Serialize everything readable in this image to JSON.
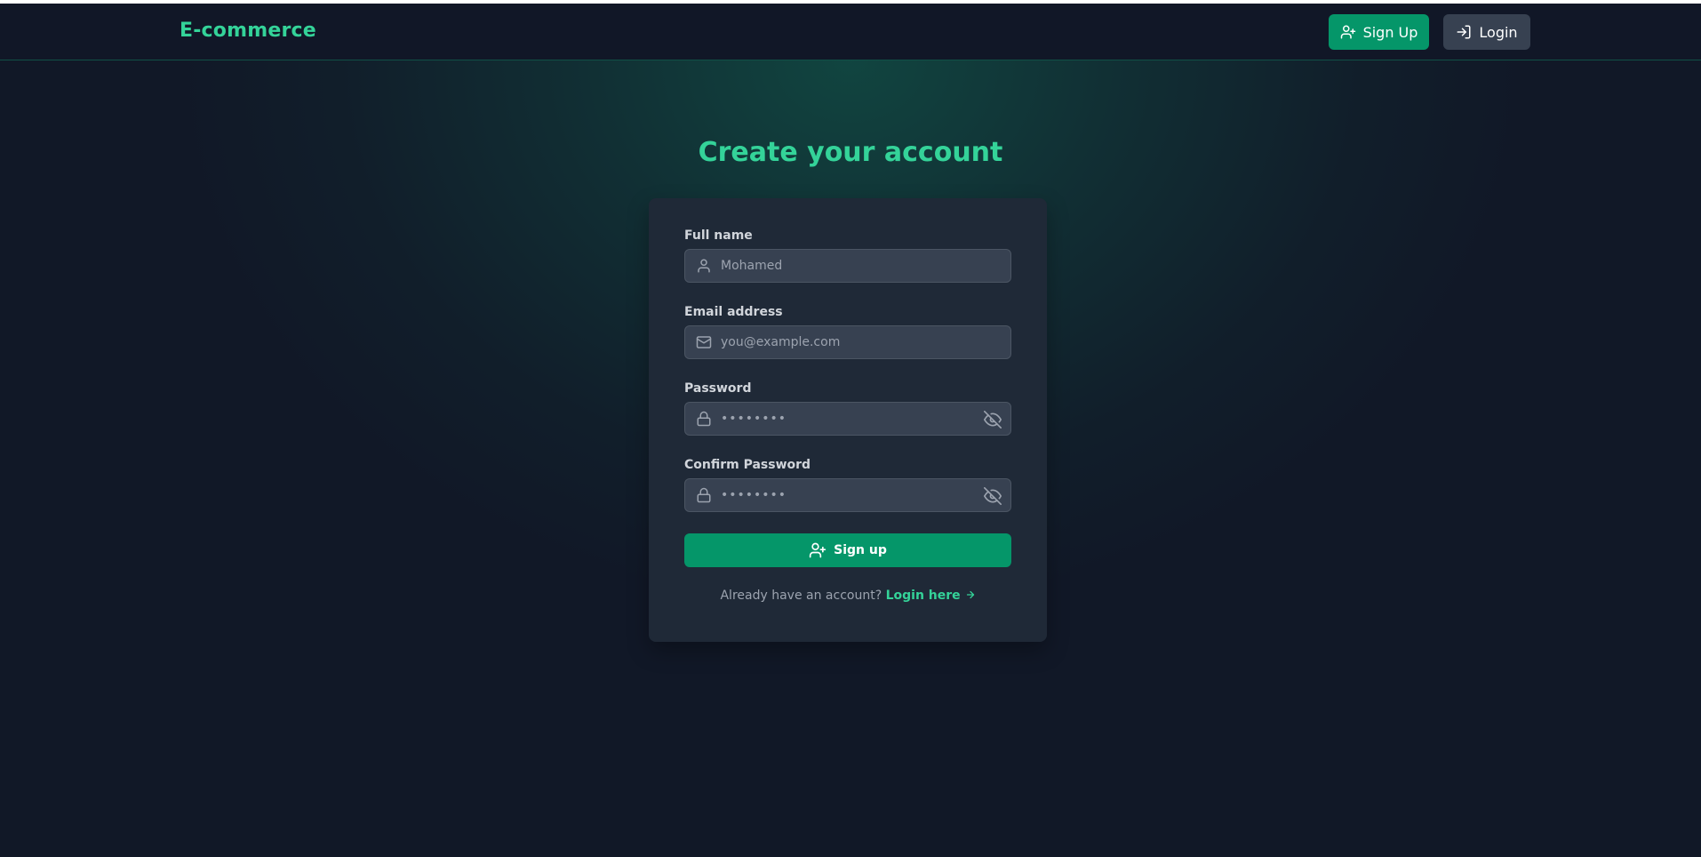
{
  "navbar": {
    "brand": "E-commerce",
    "signup_label": "Sign Up",
    "login_label": "Login"
  },
  "page": {
    "title": "Create your account"
  },
  "form": {
    "full_name": {
      "label": "Full name",
      "placeholder": "Mohamed",
      "icon": "user-icon"
    },
    "email": {
      "label": "Email address",
      "placeholder": "you@example.com",
      "icon": "mail-icon"
    },
    "password": {
      "label": "Password",
      "placeholder": "••••••••",
      "icon": "lock-icon",
      "toggle_icon": "eye-off-icon"
    },
    "confirm_password": {
      "label": "Confirm Password",
      "placeholder": "••••••••",
      "icon": "lock-icon",
      "toggle_icon": "eye-off-icon"
    },
    "submit_label": "Sign up",
    "footer_text": "Already have an account?",
    "footer_link": "Login here"
  },
  "colors": {
    "background": "#111827",
    "accent": "#34d399",
    "primary_button": "#059669",
    "card": "#1f2937",
    "input": "#374151"
  }
}
